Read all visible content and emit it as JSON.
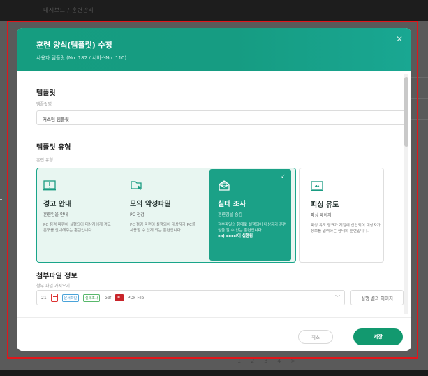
{
  "background": {
    "breadcrumb": "대시보드 / 훈련관리",
    "pagination": [
      "1",
      "2",
      "3",
      "4",
      ">"
    ]
  },
  "modal": {
    "title": "훈련 양식(템플릿) 수정",
    "subtitle": "사용자 템플릿 (No. 182 / 서비스No. 110)",
    "close_icon": "close-icon"
  },
  "template_section": {
    "title": "템플릿",
    "name_label": "템플릿명",
    "name_value": "커스텀 템플릿"
  },
  "type_section": {
    "title": "템플릿 유형",
    "label": "훈련 유형",
    "cards": [
      {
        "name": "경고 안내",
        "sub": "훈련임을 안내",
        "desc": "PC 점검 파편이 실행되어 대상자에게 경고 문구를 안내해주는 훈련입니다.",
        "icon": "warning-icon",
        "selected": false
      },
      {
        "name": "모의 악성파일",
        "sub": "PC 점검",
        "desc": "PC 점검 파편이 실행되어 대상자가 PC를 사용할 수 없게 되는 훈련입니다.",
        "icon": "file-cursor-icon",
        "selected": false
      },
      {
        "name": "실태 조사",
        "sub": "훈련임을 숨김",
        "desc": "첨부파일의 형태로 실행되어 대상자가 훈련임을 알 수 없는 훈련입니다.",
        "desc_highlight": "ex) excel이 실행됨",
        "icon": "mail-open-icon",
        "selected": true
      },
      {
        "name": "피싱 유도",
        "sub": "피싱 페이지",
        "desc": "피싱 유도 링크가 게일에 삽입되어 대상자가 정보를 입력하는 형태의 훈련입니다.",
        "icon": "phishing-icon",
        "selected": false
      }
    ]
  },
  "attachment_section": {
    "title": "첨부파일 정보",
    "label": "첨부 파일 가져오기",
    "row_number": "21",
    "tag_document": "문서파일",
    "tag_survey": "실태조사",
    "ext": "pdf",
    "ic_badge": "IC",
    "file_name": "PDF File",
    "result_button": "실행 결과 이미지"
  },
  "footer": {
    "cancel": "취소",
    "save": "저장"
  },
  "colors": {
    "header_teal": "#159d80",
    "selected_card": "#1ba187",
    "save_button": "#12996f",
    "annotation_red": "#e0161b"
  }
}
